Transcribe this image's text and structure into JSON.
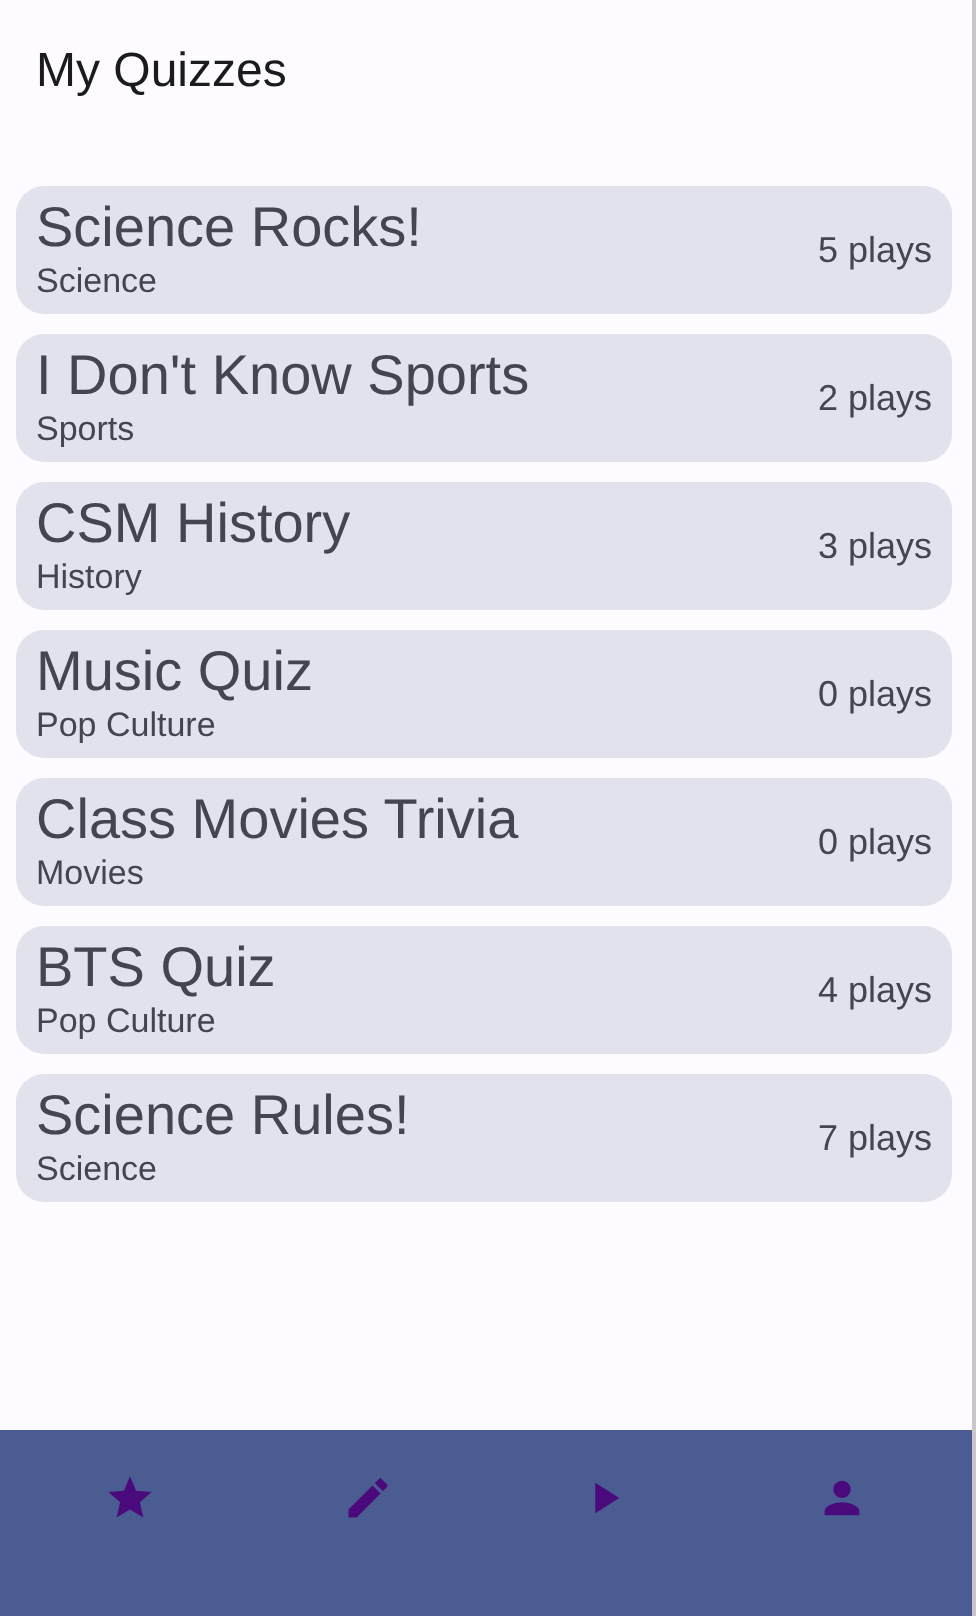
{
  "title": "My Quizzes",
  "quizzes": [
    {
      "name": "Science Rocks!",
      "category": "Science",
      "plays": "5 plays"
    },
    {
      "name": "I Don't Know Sports",
      "category": "Sports",
      "plays": "2 plays"
    },
    {
      "name": "CSM History",
      "category": "History",
      "plays": "3 plays"
    },
    {
      "name": "Music Quiz",
      "category": "Pop Culture",
      "plays": "0 plays"
    },
    {
      "name": "Class Movies Trivia",
      "category": "Movies",
      "plays": "0 plays"
    },
    {
      "name": "BTS Quiz",
      "category": "Pop Culture",
      "plays": "4 plays"
    },
    {
      "name": "Science Rules!",
      "category": "Science",
      "plays": "7 plays"
    }
  ],
  "nav": [
    {
      "kind": "star"
    },
    {
      "kind": "pencil"
    },
    {
      "kind": "play"
    },
    {
      "kind": "person"
    }
  ]
}
